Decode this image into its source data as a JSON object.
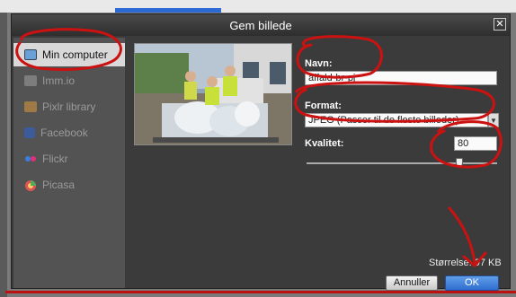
{
  "dialog": {
    "title": "Gem billede",
    "close_glyph": "✕"
  },
  "sidebar": {
    "items": [
      {
        "label": "Min computer",
        "icon": "computer-icon",
        "color": "#6aa0d8"
      },
      {
        "label": "Imm.io",
        "icon": "immio-icon",
        "color": "#7d7d7d"
      },
      {
        "label": "Pixlr library",
        "icon": "folder-icon",
        "color": "#b08a50"
      },
      {
        "label": "Facebook",
        "icon": "facebook-icon",
        "color": "#3b5b9a"
      },
      {
        "label": "Flickr",
        "icon": "flickr-icon",
        "color": "#e0307a"
      },
      {
        "label": "Picasa",
        "icon": "picasa-icon",
        "color": "#c77"
      }
    ]
  },
  "form": {
    "name_label": "Navn:",
    "name_value": "affald-br-pj",
    "format_label": "Format:",
    "format_value": "JPEG (Passer til de fleste billeder)",
    "quality_label": "Kvalitet:",
    "quality_value": "80",
    "quality_level_percent": 80,
    "size_text": "Størrelse: 97 KB"
  },
  "buttons": {
    "cancel": "Annuller",
    "ok": "OK"
  },
  "colors": {
    "annotation": "#cc1111",
    "ok_button": "#2f6ed0"
  }
}
